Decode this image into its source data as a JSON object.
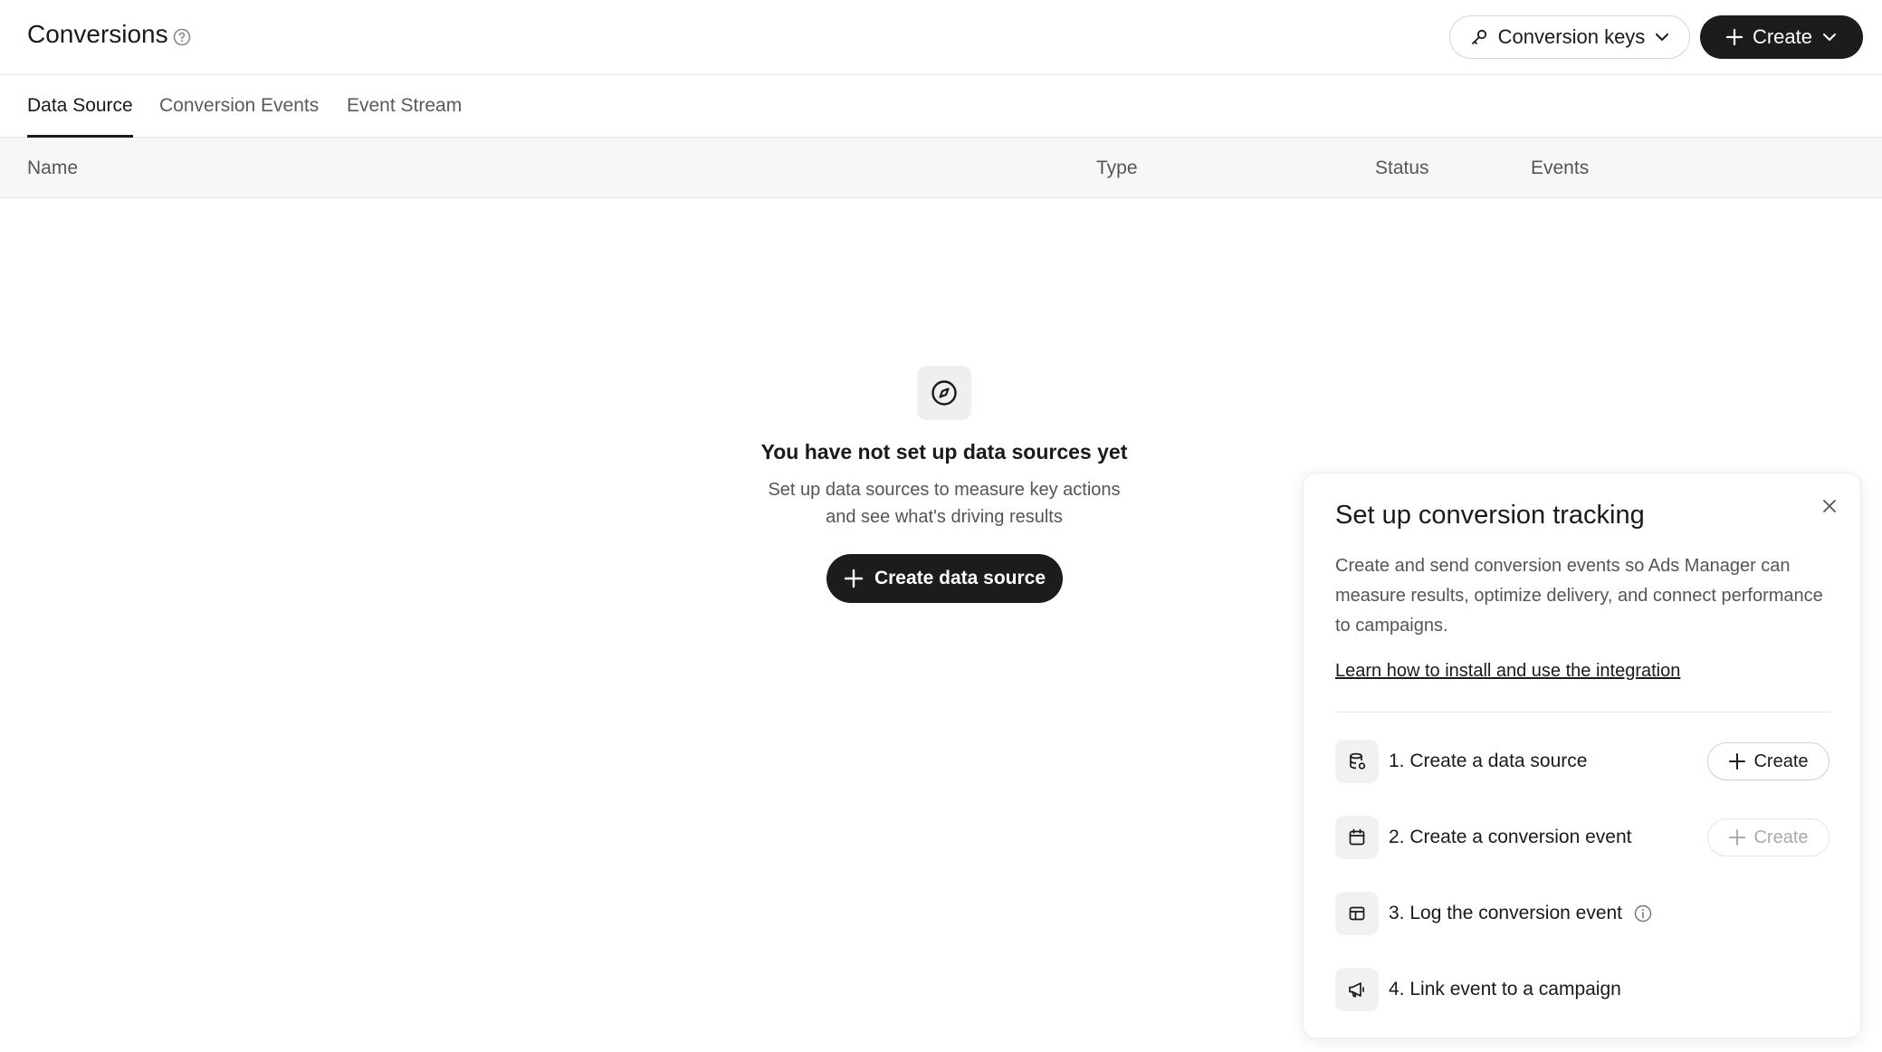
{
  "header": {
    "title": "Conversions",
    "conversion_keys_label": "Conversion keys",
    "create_label": "Create"
  },
  "tabs": [
    {
      "label": "Data Source",
      "active": true
    },
    {
      "label": "Conversion Events",
      "active": false
    },
    {
      "label": "Event Stream",
      "active": false
    }
  ],
  "table": {
    "columns": [
      "Name",
      "Type",
      "Status",
      "Events"
    ]
  },
  "empty_state": {
    "icon": "compass-icon",
    "title": "You have not set up data sources yet",
    "description": "Set up data sources to measure key actions and see what's driving results",
    "button_label": "Create data source"
  },
  "setup_panel": {
    "title": "Set up conversion tracking",
    "description": "Create and send conversion events so Ads Manager can measure results, optimize delivery, and connect performance to campaigns.",
    "link_label": "Learn how to install and use the integration",
    "steps": [
      {
        "label": "1. Create a data source",
        "icon": "database-icon",
        "button_label": "Create",
        "button_enabled": true
      },
      {
        "label": "2. Create a conversion event",
        "icon": "calendar-icon",
        "button_label": "Create",
        "button_enabled": false
      },
      {
        "label": "3. Log the conversion event",
        "icon": "layout-icon"
      },
      {
        "label": "4. Link event to a campaign",
        "icon": "megaphone-icon"
      }
    ]
  },
  "colors": {
    "primary_dark": "#1c1c1c",
    "border": "#e6e6e6",
    "muted_text": "#555555",
    "table_header_bg": "#f7f7f7"
  }
}
